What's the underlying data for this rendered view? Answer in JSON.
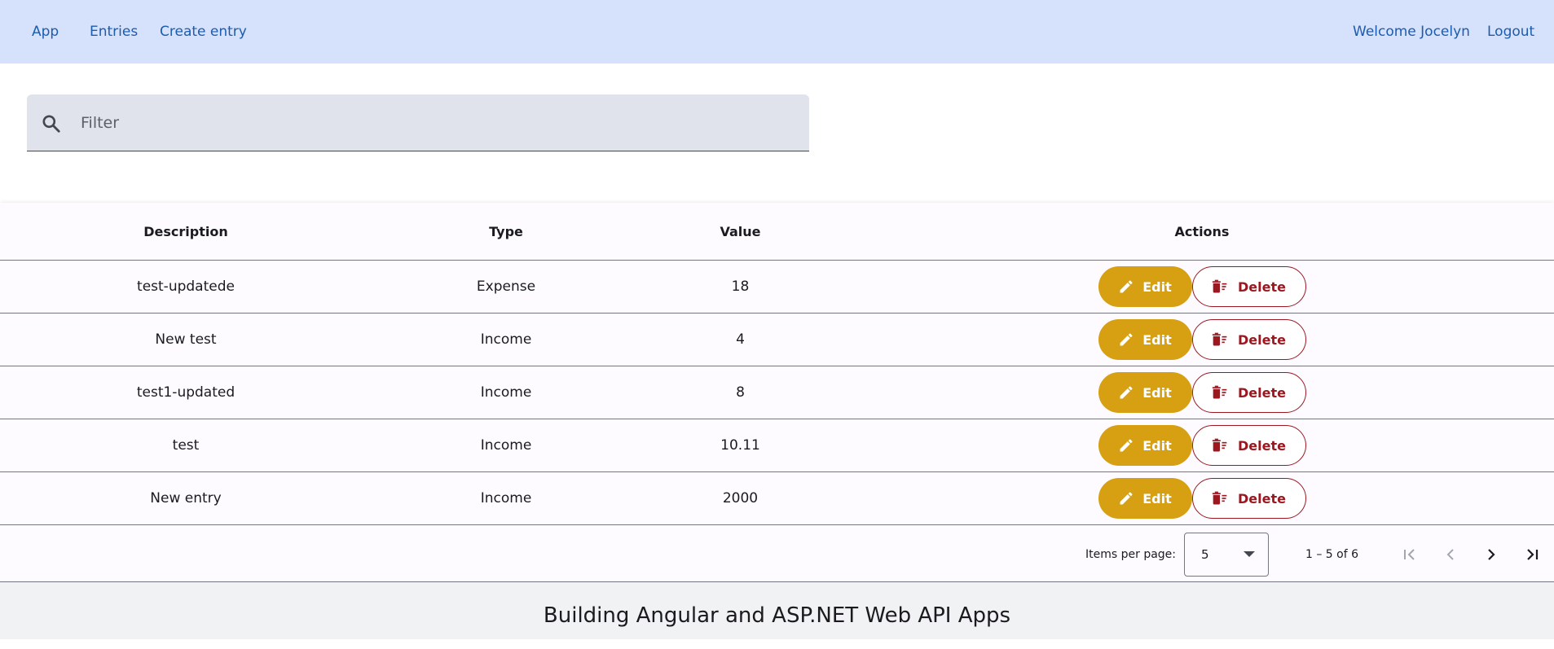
{
  "nav": {
    "app_label": "App",
    "entries_label": "Entries",
    "create_label": "Create entry",
    "welcome_text": "Welcome Jocelyn",
    "logout_label": "Logout"
  },
  "filter": {
    "placeholder": "Filter",
    "icon": "search-icon"
  },
  "table": {
    "headers": {
      "description": "Description",
      "type": "Type",
      "value": "Value",
      "actions": "Actions"
    },
    "edit_label": "Edit",
    "delete_label": "Delete",
    "rows": [
      {
        "description": "test-updatede",
        "type": "Expense",
        "value": "18"
      },
      {
        "description": "New test",
        "type": "Income",
        "value": "4"
      },
      {
        "description": "test1-updated",
        "type": "Income",
        "value": "8"
      },
      {
        "description": "test",
        "type": "Income",
        "value": "10.11"
      },
      {
        "description": "New entry",
        "type": "Income",
        "value": "2000"
      }
    ]
  },
  "paginator": {
    "items_per_page_label": "Items per page:",
    "page_size": "5",
    "range_label": "1 – 5 of 6"
  },
  "footer": {
    "text": "Building Angular and ASP.NET Web API Apps"
  },
  "colors": {
    "topbar_bg": "#d6e2fb",
    "link": "#1c5cae",
    "edit_bg": "#d6a012",
    "delete_accent": "#9b1820"
  }
}
